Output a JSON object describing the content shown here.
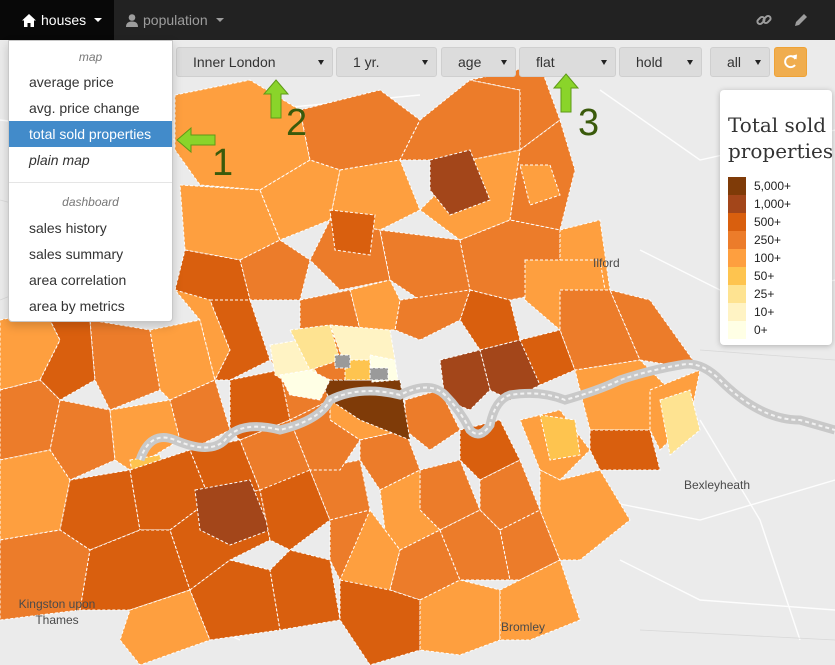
{
  "navbar": {
    "houses_label": "houses",
    "population_label": "population",
    "icons": [
      "home-icon",
      "user-icon",
      "link-icon",
      "pencil-icon"
    ]
  },
  "filters": {
    "area": "Inner London",
    "period": "1 yr.",
    "age": "age",
    "type": "flat",
    "tenure": "hold",
    "scope": "all"
  },
  "menu": {
    "map_header": "map",
    "map_items": [
      "average price",
      "avg. price change",
      "total sold properties",
      "plain map"
    ],
    "selected": "total sold properties",
    "dashboard_header": "dashboard",
    "dashboard_items": [
      "sales history",
      "sales summary",
      "area correlation",
      "area by metrics"
    ]
  },
  "legend": {
    "title": "Total sold properties",
    "items": [
      {
        "label": "5,000+",
        "color": "#7f3b08"
      },
      {
        "label": "1,000+",
        "color": "#a3461a"
      },
      {
        "label": "500+",
        "color": "#d95f0e"
      },
      {
        "label": "250+",
        "color": "#ec7c2a"
      },
      {
        "label": "100+",
        "color": "#fe9f3f"
      },
      {
        "label": "50+",
        "color": "#fec44f"
      },
      {
        "label": "25+",
        "color": "#fee391"
      },
      {
        "label": "10+",
        "color": "#fff3c4"
      },
      {
        "label": "0+",
        "color": "#ffffe5"
      }
    ]
  },
  "places": {
    "ilford": "Ilford",
    "bexleyheath": "Bexleyheath",
    "kingston": "Kingston upon Thames",
    "bromley": "Bromley"
  },
  "annotations": [
    "1",
    "2",
    "3"
  ],
  "colors": {
    "navbar_bg": "#222222",
    "accent_blue": "#428bca",
    "refresh_orange": "#f0ad4e",
    "arrow_green": "#7dc81e"
  }
}
